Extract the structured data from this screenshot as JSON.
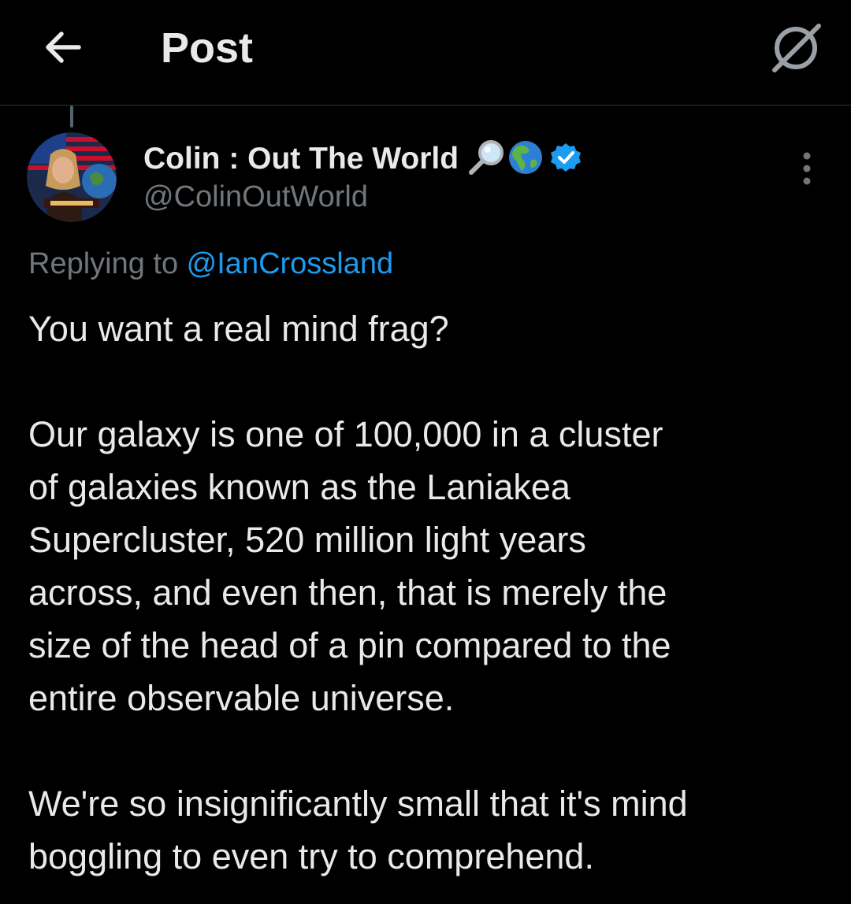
{
  "header": {
    "back_icon": "arrow-left-icon",
    "title": "Post",
    "grok_icon": "grok-icon"
  },
  "author": {
    "display_name": "Colin : Out The World",
    "emojis": [
      "magnifying-glass-icon",
      "globe-americas-icon"
    ],
    "verified_icon": "verified-badge-icon",
    "handle": "@ColinOutWorld",
    "avatar_icon": "avatar"
  },
  "reply": {
    "prefix": "Replying to ",
    "mention": "@IanCrossland"
  },
  "tweet": {
    "paragraphs": [
      "You want a real mind frag?",
      "Our galaxy is one of 100,000 in a cluster\nof galaxies known as the Laniakea\nSupercluster, 520 million light years\nacross, and even then, that is merely the\nsize of the head of a pin compared to the\nentire observable universe.",
      "We're so insignificantly small that it's mind\nboggling to even try to comprehend."
    ]
  },
  "colors": {
    "background": "#000000",
    "text_primary": "#e7e9ea",
    "text_secondary": "#71767b",
    "accent": "#1d9bf0",
    "divider": "#2f3336"
  }
}
